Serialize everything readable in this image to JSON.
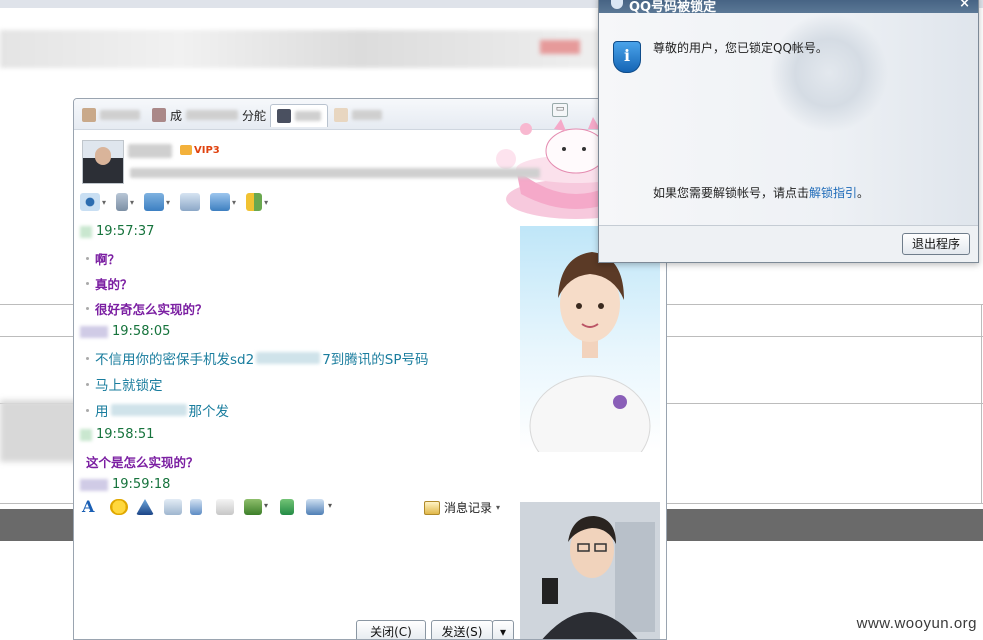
{
  "chat": {
    "tabs": [
      {
        "label": ""
      },
      {
        "label": "成",
        "label_suffix": "分舵"
      },
      {
        "label": ""
      },
      {
        "label": ""
      }
    ],
    "vip_label": "VIP3",
    "messages": [
      {
        "time": "19:57:37",
        "lines": [
          "啊？",
          "真的？",
          "很好奇怎么实现的？"
        ],
        "style": "purple"
      },
      {
        "time": "19:58:05",
        "lines": [
          "不信用你的密保手机发sd2",
          "7到腾讯的SP号码",
          "马上就锁定",
          "用",
          "那个发"
        ],
        "style": "teal"
      },
      {
        "time": "19:58:51",
        "lines": [
          "这个是怎么实现的？"
        ],
        "style": "purple"
      },
      {
        "time": "19:59:18",
        "lines": [],
        "style": "teal"
      }
    ],
    "history_label": "消息记录",
    "close_button": "关闭(C)",
    "send_button": "发送(S)"
  },
  "dialog": {
    "title": "QQ号码被锁定",
    "greeting": "尊敬的用户，您已锁定QQ帐号。",
    "unlock_prefix": "如果您需要解锁帐号，请点击",
    "unlock_link": "解锁指引",
    "unlock_suffix": "。",
    "exit_button": "退出程序"
  },
  "watermark": "www.wooyun.org"
}
